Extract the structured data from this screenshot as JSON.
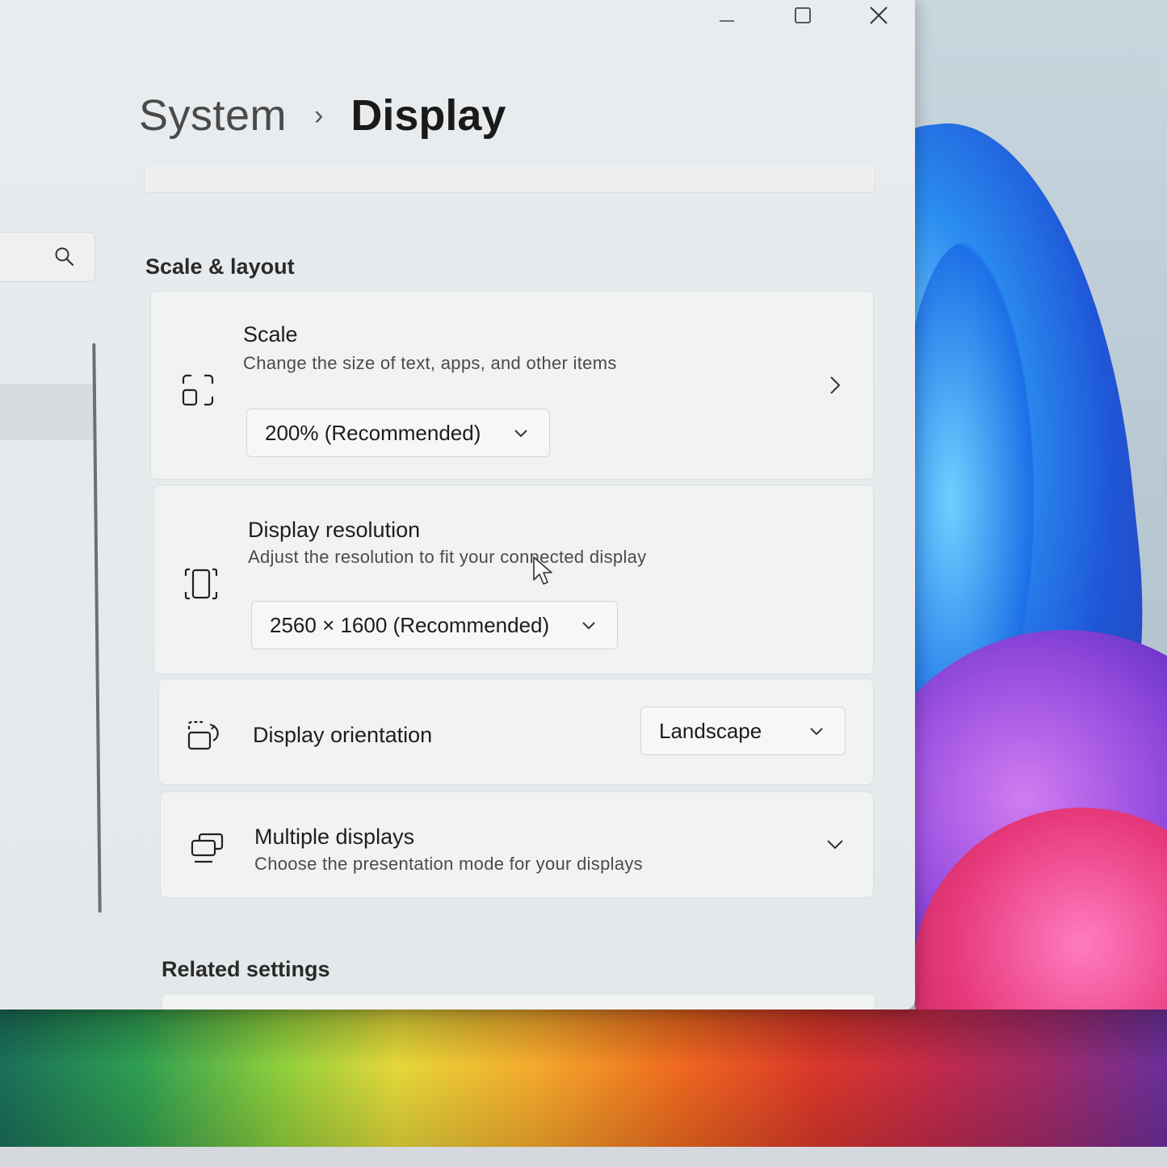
{
  "window": {
    "breadcrumb_parent": "System",
    "breadcrumb_separator": "›",
    "breadcrumb_current": "Display",
    "caption_buttons": [
      "minimize-icon",
      "maximize-icon",
      "close-icon"
    ]
  },
  "nav": {
    "search_icon": "search-icon"
  },
  "sections": {
    "scale_layout": "Scale & layout",
    "related_settings": "Related settings"
  },
  "settings": {
    "scale": {
      "icon": "scale-icon",
      "title": "Scale",
      "description": "Change the size of text, apps, and other items",
      "value": "200% (Recommended)"
    },
    "resolution": {
      "icon": "resolution-icon",
      "title": "Display resolution",
      "description": "Adjust the resolution to fit your connected display",
      "value": "2560 × 1600 (Recommended)"
    },
    "orientation": {
      "icon": "rotate-display-icon",
      "title": "Display orientation",
      "value": "Landscape"
    },
    "multiple_displays": {
      "icon": "multiple-displays-icon",
      "title": "Multiple displays",
      "description": "Choose the presentation mode for your displays"
    }
  }
}
